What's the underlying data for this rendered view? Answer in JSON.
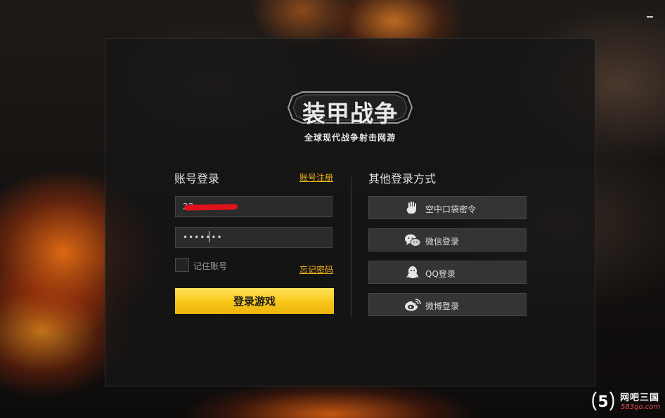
{
  "window": {
    "minimize_icon": "minimize-icon"
  },
  "logo": {
    "title": "装甲战争",
    "slogan": "全球现代战争射击网游"
  },
  "login": {
    "title": "账号登录",
    "register_link": "账号注册",
    "username_value": "23",
    "password_value": "•••••••",
    "remember_label": "记住账号",
    "forgot_link": "忘记密码",
    "login_button": "登录游戏"
  },
  "other_login": {
    "title": "其他登录方式",
    "options": [
      {
        "label": "空中口袋密令",
        "icon": "hand-icon"
      },
      {
        "label": "微信登录",
        "icon": "wechat-icon"
      },
      {
        "label": "QQ登录",
        "icon": "qq-icon"
      },
      {
        "label": "微博登录",
        "icon": "weibo-icon"
      }
    ]
  },
  "watermark": {
    "logo_text": "5",
    "name": "网吧三国",
    "domain": "583go.com"
  },
  "colors": {
    "accent": "#f8c91d",
    "link": "#f0b21a",
    "panel": "#161616",
    "redaction": "#e0121b"
  }
}
